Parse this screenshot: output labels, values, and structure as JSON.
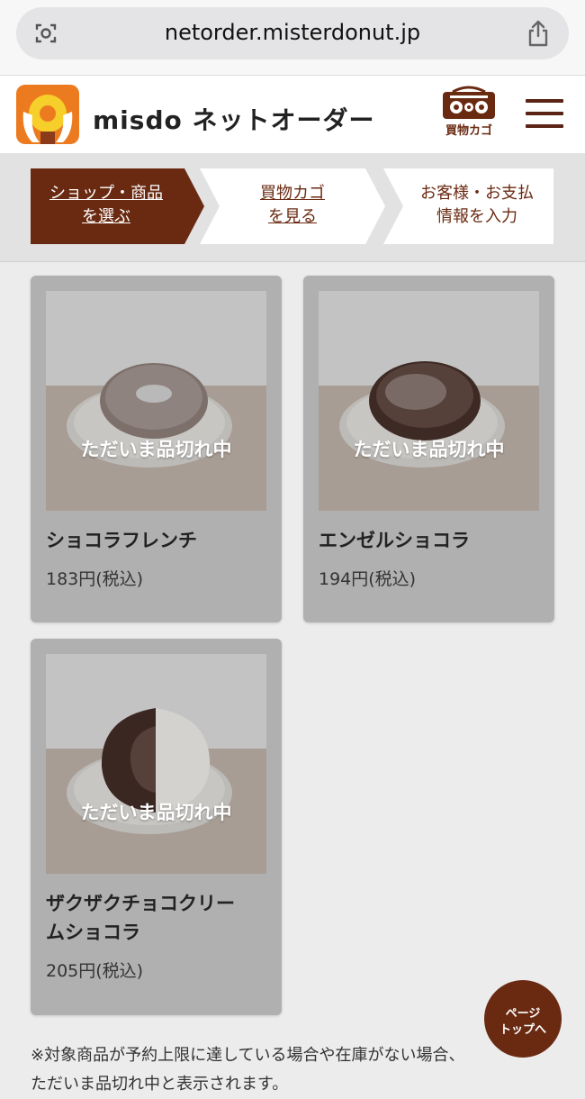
{
  "browser": {
    "url": "netorder.misterdonut.jp"
  },
  "header": {
    "title": "misdo ネットオーダー",
    "cart_label": "買物カゴ"
  },
  "steps": [
    {
      "line1": "ショップ・商品",
      "line2": "を選ぶ",
      "active": true
    },
    {
      "line1": "買物カゴ",
      "line2": "を見る",
      "active": false
    },
    {
      "line1": "お客様・お支払",
      "line2": "情報を入力",
      "active": false
    }
  ],
  "products": [
    {
      "name_line1": "ショコラフレンチ",
      "name_line2": "",
      "price": "183円(税込)",
      "status": "ただいま品切れ中",
      "icon": "donut-french-image"
    },
    {
      "name_line1": "エンゼルショコラ",
      "name_line2": "",
      "price": "194円(税込)",
      "status": "ただいま品切れ中",
      "icon": "donut-angel-image"
    },
    {
      "name_line1": "ザクザクチョコクリー",
      "name_line2": "ムショコラ",
      "price": "205円(税込)",
      "status": "ただいま品切れ中",
      "icon": "donut-zakuzaku-image"
    }
  ],
  "page_top": {
    "line1": "ページ",
    "line2": "トップへ"
  },
  "note": {
    "line1": "※対象商品が予約上限に達している場合や在庫がない場合、",
    "line2": "ただいま品切れ中と表示されます。"
  },
  "colors": {
    "brand_brown": "#6a2a12",
    "brand_orange": "#ec7b1f",
    "card_gray": "#b0b0b0"
  }
}
